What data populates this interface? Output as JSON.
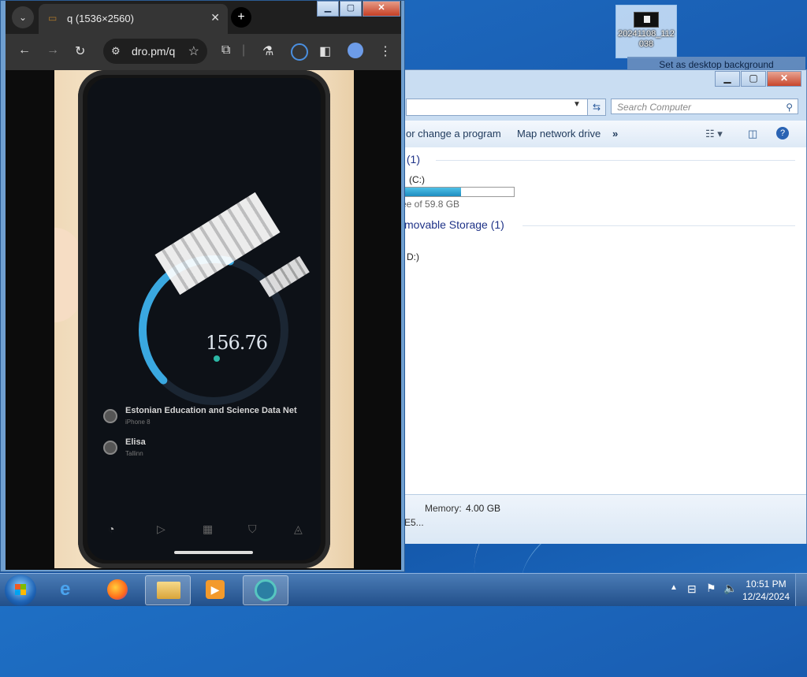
{
  "desktop": {
    "icon_label_line1": "20241108_112",
    "icon_label_line2": "038",
    "tooltip": "Set as desktop background"
  },
  "explorer": {
    "search_placeholder": "Search Computer",
    "commands": {
      "uninstall": "or change a program",
      "map_drive": "Map network drive",
      "more": "»"
    },
    "groups": {
      "hard_disks": "s (1)",
      "removable": "movable Storage (1)"
    },
    "drive_c": {
      "name": "(C:)",
      "free_text": "ee of 59.8 GB",
      "used_fraction": 0.55
    },
    "drive_d": {
      "name": "D:)"
    },
    "details": {
      "memory_label": "Memory:",
      "memory_value": "4.00 GB",
      "processor_partial": "E5..."
    }
  },
  "chrome": {
    "tab_title": "q (1536×2560)",
    "url": "dro.pm/q",
    "new_tab": "+",
    "tab_close": "✕",
    "caption": {
      "min": "▁",
      "max": "▢",
      "close": "✕"
    }
  },
  "photo": {
    "speed_value": "156.76",
    "servers": [
      {
        "name": "Estonian Education and Science Data Net",
        "sub": "iPhone 8"
      },
      {
        "name": "Elisa",
        "sub": "Tallinn"
      }
    ],
    "gauge_fraction": 0.55
  },
  "taskbar": {
    "time": "10:51 PM",
    "date": "12/24/2024"
  },
  "colors": {
    "accent": "#1d8cbf",
    "gauge": "#3aa8e0"
  }
}
